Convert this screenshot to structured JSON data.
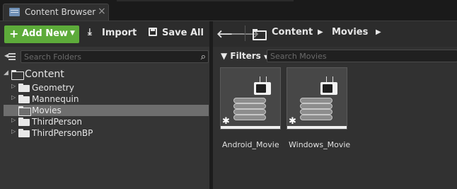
{
  "tab": {
    "title": "Content Browser",
    "close_label": "×"
  },
  "toolbar": {
    "add_new_label": "Add New",
    "import_label": "Import",
    "save_all_label": "Save All"
  },
  "folders": {
    "search_placeholder": "Search Folders",
    "root_label": "Content",
    "items": [
      {
        "label": "Geometry"
      },
      {
        "label": "Mannequin"
      },
      {
        "label": "Movies",
        "selected": true
      },
      {
        "label": "ThirdPerson"
      },
      {
        "label": "ThirdPersonBP"
      }
    ]
  },
  "breadcrumb": {
    "items": [
      {
        "label": "Content"
      },
      {
        "label": "Movies"
      }
    ]
  },
  "assets": {
    "filters_label": "Filters",
    "search_placeholder": "Search Movies",
    "items": [
      {
        "label": "Android_Movie"
      },
      {
        "label": "Windows_Movie"
      }
    ]
  },
  "colors": {
    "add_new_accent": "#5dab3a",
    "selection": "#6e6e6e"
  }
}
